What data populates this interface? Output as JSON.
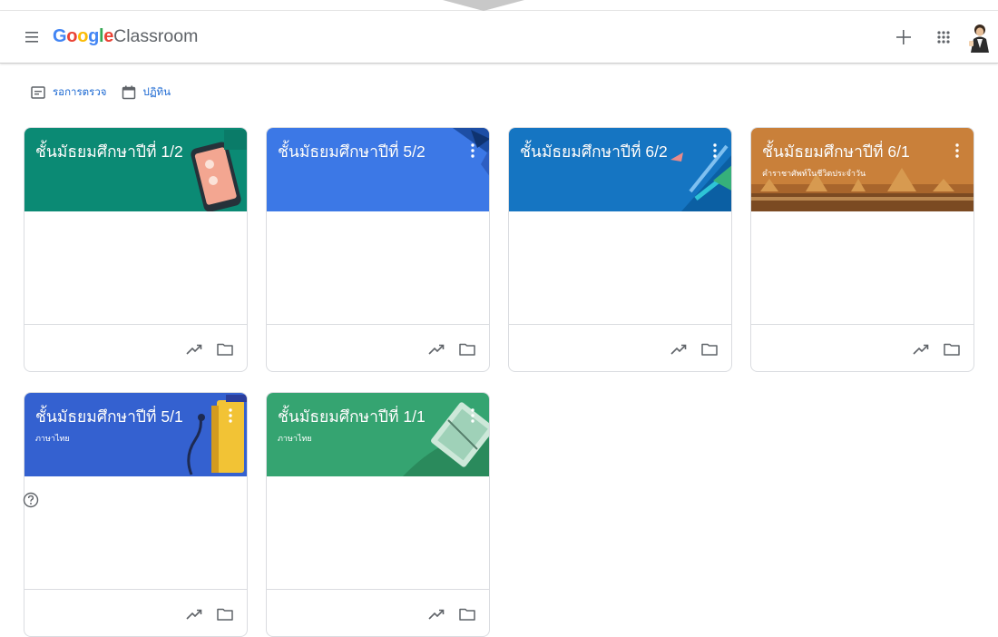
{
  "app": {
    "brand_google": "Google",
    "brand_product": "Classroom"
  },
  "subnav": {
    "todo_label": "รอการตรวจ",
    "calendar_label": "ปฏิทิน"
  },
  "cards": [
    {
      "title": "ชั้นมัธยมศึกษาปีที่ 1/2",
      "section": "",
      "color": "#0b8a74"
    },
    {
      "title": "ชั้นมัธยมศึกษาปีที่ 5/2",
      "section": "",
      "color": "#3c78e6"
    },
    {
      "title": "ชั้นมัธยมศึกษาปีที่ 6/2",
      "section": "",
      "color": "#1575c2"
    },
    {
      "title": "ชั้นมัธยมศึกษาปีที่ 6/1",
      "section": "คำราชาศัพท์ในชีวิตประจำวัน",
      "color": "#c9803a"
    },
    {
      "title": "ชั้นมัธยมศึกษาปีที่ 5/1",
      "section": "ภาษาไทย",
      "color": "#3461d0"
    },
    {
      "title": "ชั้นมัธยมศึกษาปีที่ 1/1",
      "section": "ภาษาไทย",
      "color": "#35a471"
    }
  ],
  "icons": {
    "menu": "hamburger-menu-icon",
    "create": "plus-icon",
    "apps": "apps-grid-icon",
    "todo": "todo-list-icon",
    "calendar": "calendar-icon",
    "more": "more-vert-icon",
    "gradebook": "trending-up-icon",
    "drive_folder": "folder-icon",
    "help": "help-icon"
  }
}
